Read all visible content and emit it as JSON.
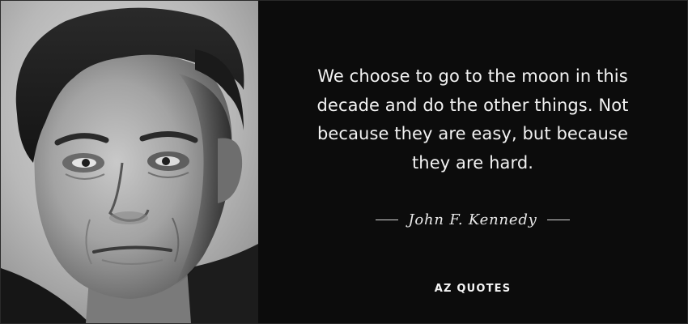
{
  "quote": {
    "lines": [
      "We choose to go to the moon in this",
      "decade and do the other things. Not",
      "because they are easy, but because",
      "they are hard."
    ],
    "author": "John F. Kennedy"
  },
  "brand": {
    "logo_text": "AZ QUOTES"
  },
  "colors": {
    "background": "#0c0c0c",
    "text": "#f2f2f2"
  }
}
